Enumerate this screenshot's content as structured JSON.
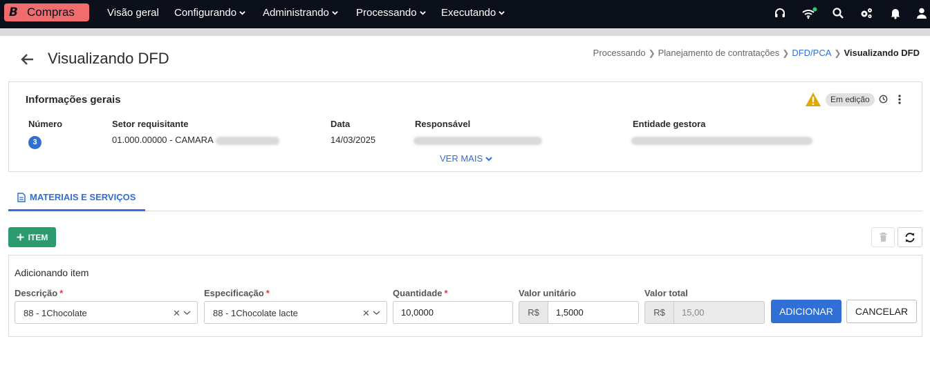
{
  "app": {
    "brand_letter": "B",
    "brand_name": "Compras"
  },
  "nav": {
    "items": [
      {
        "label": "Visão geral",
        "dropdown": false
      },
      {
        "label": "Configurando",
        "dropdown": true
      },
      {
        "label": "Administrando",
        "dropdown": true
      },
      {
        "label": "Processando",
        "dropdown": true
      },
      {
        "label": "Executando",
        "dropdown": true
      }
    ],
    "icons": [
      "headset-icon",
      "wifi-icon",
      "search-icon",
      "settings-icon",
      "bell-icon",
      "user-icon"
    ],
    "wifi_status_color": "#2ecc71"
  },
  "page": {
    "title": "Visualizando DFD"
  },
  "breadcrumb": {
    "items": [
      "Processando",
      "Planejamento de contratações",
      "DFD/PCA",
      "Visualizando DFD"
    ]
  },
  "info": {
    "title": "Informações gerais",
    "status": "Em edição",
    "fields": {
      "numero_label": "Número",
      "numero_value": "3",
      "setor_label": "Setor requisitante",
      "setor_value": "01.000.00000 - CAMARA",
      "data_label": "Data",
      "data_value": "14/03/2025",
      "responsavel_label": "Responsável",
      "entidade_label": "Entidade gestora"
    },
    "ver_mais": "VER MAIS"
  },
  "tabs": {
    "active": "MATERIAIS E SERVIÇOS"
  },
  "toolbar": {
    "add_item": "ITEM"
  },
  "form": {
    "title": "Adicionando item",
    "descricao_label": "Descrição",
    "descricao_value": "88 - 1Chocolate",
    "especificacao_label": "Especificação",
    "especificacao_value": "88 - 1Chocolate lacte",
    "quantidade_label": "Quantidade",
    "quantidade_value": "10,0000",
    "valor_unitario_label": "Valor unitário",
    "valor_unitario_prefix": "R$",
    "valor_unitario_value": "1,5000",
    "valor_total_label": "Valor total",
    "valor_total_prefix": "R$",
    "valor_total_value": "15,00",
    "add_button": "ADICIONAR",
    "cancel_button": "CANCELAR"
  },
  "colors": {
    "accent": "#2f6fd6",
    "success": "#2a9b6e",
    "brand": "#f16d6d",
    "topbar": "#0b0f1a",
    "warning": "#e0a800"
  }
}
